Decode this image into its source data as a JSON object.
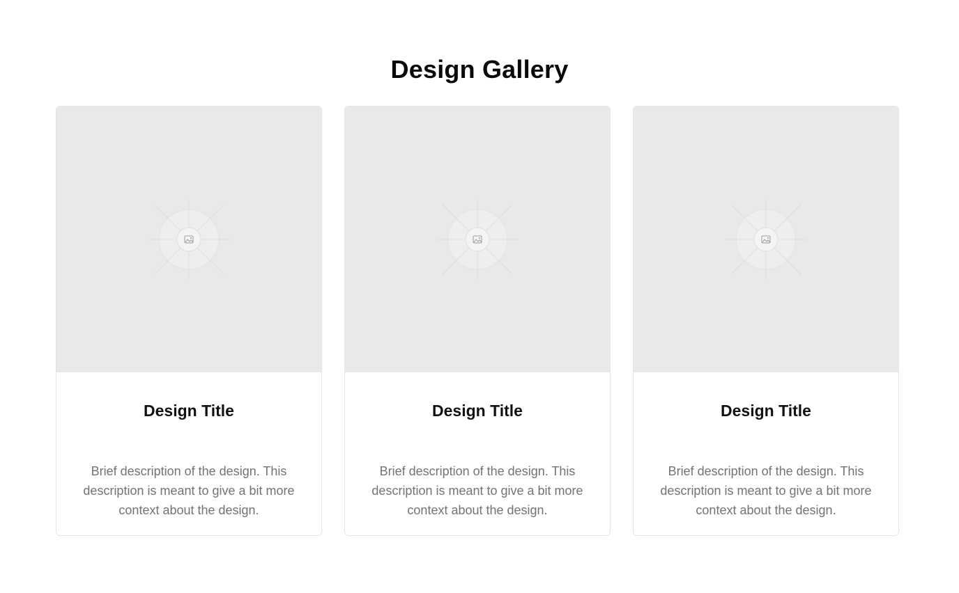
{
  "header": {
    "title": "Design Gallery"
  },
  "cards": [
    {
      "image_icon": "image-placeholder-icon",
      "title": "Design Title",
      "description": "Brief description of the design. This description is meant to give a bit more context about the design."
    },
    {
      "image_icon": "image-placeholder-icon",
      "title": "Design Title",
      "description": "Brief description of the design. This description is meant to give a bit more context about the design."
    },
    {
      "image_icon": "image-placeholder-icon",
      "title": "Design Title",
      "description": "Brief description of the design. This description is meant to give a bit more context about the design."
    }
  ],
  "colors": {
    "background": "#ffffff",
    "image_placeholder": "#e9e9e9",
    "title_text": "#111111",
    "description_text": "#737373",
    "card_border": "#e5e5e5"
  }
}
